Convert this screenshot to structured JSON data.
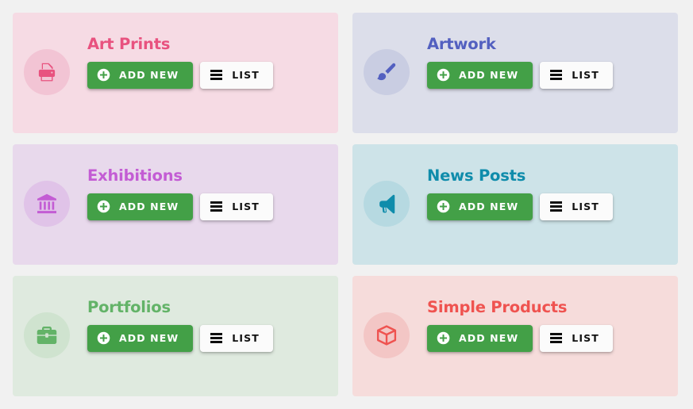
{
  "page": {
    "background": "#f1f1f1",
    "columns": 2,
    "rows": 3
  },
  "buttons": {
    "add_label": "ADD NEW",
    "list_label": "LIST",
    "add_color": "#43a047",
    "list_color": "#fbfbfb",
    "add_icon": "plus-circle-icon",
    "list_icon": "list-lines-icon"
  },
  "cards": [
    {
      "title": "Art Prints",
      "icon": "printer-icon",
      "card_bg": "#f6dbe4",
      "avatar_bg": "#f2c4d4",
      "accent": "#e8527f",
      "title_color": "#e8527f"
    },
    {
      "title": "Artwork",
      "icon": "paintbrush-icon",
      "card_bg": "#dcdeea",
      "avatar_bg": "#c9cde2",
      "accent": "#5360c0",
      "title_color": "#5360c0"
    },
    {
      "title": "Exhibitions",
      "icon": "museum-icon",
      "card_bg": "#e8d9ec",
      "avatar_bg": "#e0c3e8",
      "accent": "#c35cd4",
      "title_color": "#c35cd4"
    },
    {
      "title": "News Posts",
      "icon": "megaphone-icon",
      "card_bg": "#cde3e8",
      "avatar_bg": "#b6d9e1",
      "accent": "#0f8cab",
      "title_color": "#0f8cab"
    },
    {
      "title": "Portfolios",
      "icon": "briefcase-icon",
      "card_bg": "#dfeadf",
      "avatar_bg": "#cfe3cf",
      "accent": "#63b368",
      "title_color": "#63b368"
    },
    {
      "title": "Simple Products",
      "icon": "cube-icon",
      "card_bg": "#f6dcdb",
      "avatar_bg": "#f3c6c5",
      "accent": "#ef5350",
      "title_color": "#ef5350"
    }
  ]
}
